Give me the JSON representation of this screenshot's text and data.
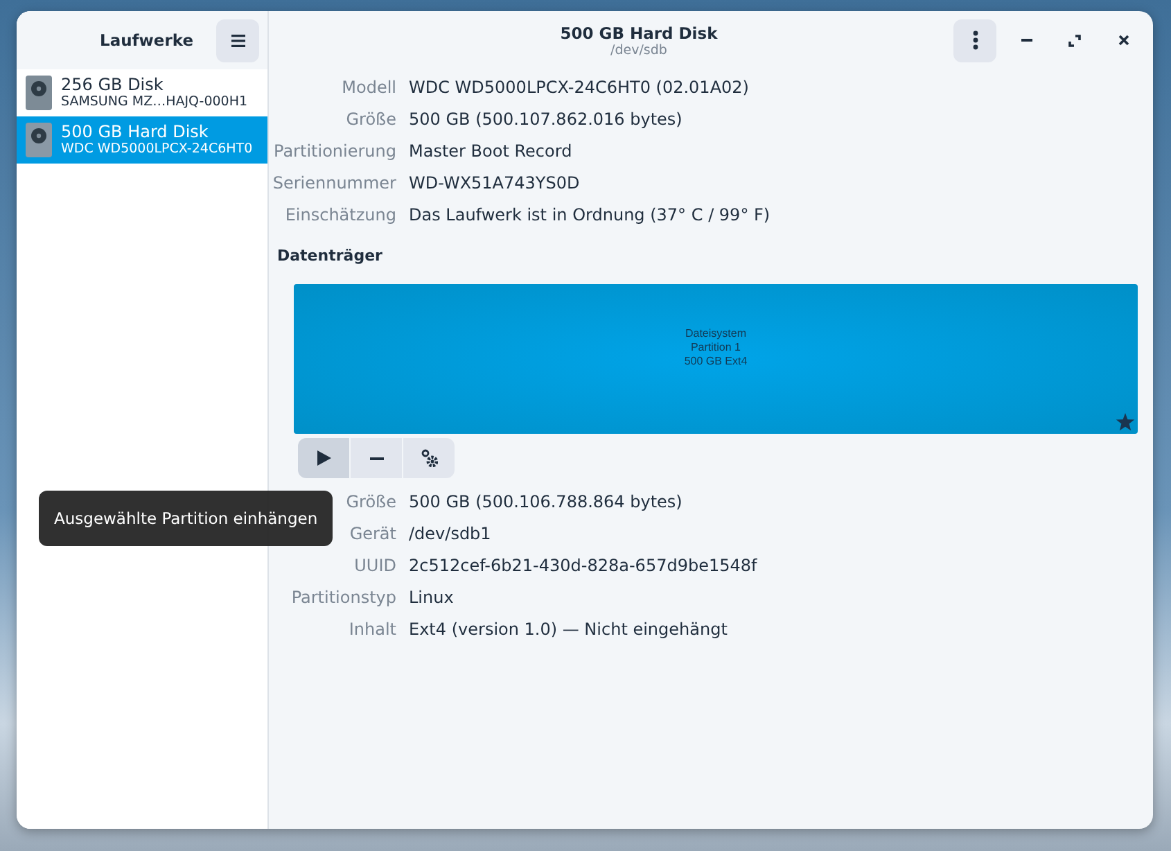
{
  "sidebar": {
    "title": "Laufwerke",
    "items": [
      {
        "name": "256 GB Disk",
        "subtitle": "SAMSUNG MZ…HAJQ-000H1",
        "selected": false
      },
      {
        "name": "500 GB Hard Disk",
        "subtitle": "WDC WD5000LPCX-24C6HT0",
        "selected": true
      }
    ]
  },
  "header": {
    "title": "500 GB Hard Disk",
    "subtitle": "/dev/sdb"
  },
  "drive_details": [
    {
      "label": "Modell",
      "value": "WDC WD5000LPCX-24C6HT0 (02.01A02)"
    },
    {
      "label": "Größe",
      "value": "500 GB (500.107.862.016 bytes)"
    },
    {
      "label": "Partitionierung",
      "value": "Master Boot Record"
    },
    {
      "label": "Seriennummer",
      "value": "WD-WX51A743YS0D"
    },
    {
      "label": "Einschätzung",
      "value": "Das Laufwerk ist in Ordnung (37° C / 99° F)"
    }
  ],
  "volumes": {
    "title": "Datenträger",
    "partition": {
      "lines": [
        "Dateisystem",
        "Partition 1",
        "500 GB Ext4"
      ]
    },
    "toolbar": [
      {
        "kind": "play",
        "active": true
      },
      {
        "kind": "minus",
        "active": false
      },
      {
        "kind": "gear",
        "active": false
      }
    ]
  },
  "tooltip": "Ausgewählte Partition einhängen",
  "partition_details": [
    {
      "label": "Größe",
      "value": "500 GB (500.106.788.864 bytes)"
    },
    {
      "label": "Gerät",
      "value": "/dev/sdb1"
    },
    {
      "label": "UUID",
      "value": "2c512cef-6b21-430d-828a-657d9be1548f"
    },
    {
      "label": "Partitionstyp",
      "value": "Linux"
    },
    {
      "label": "Inhalt",
      "value": "Ext4 (version 1.0) — Nicht eingehängt"
    }
  ]
}
